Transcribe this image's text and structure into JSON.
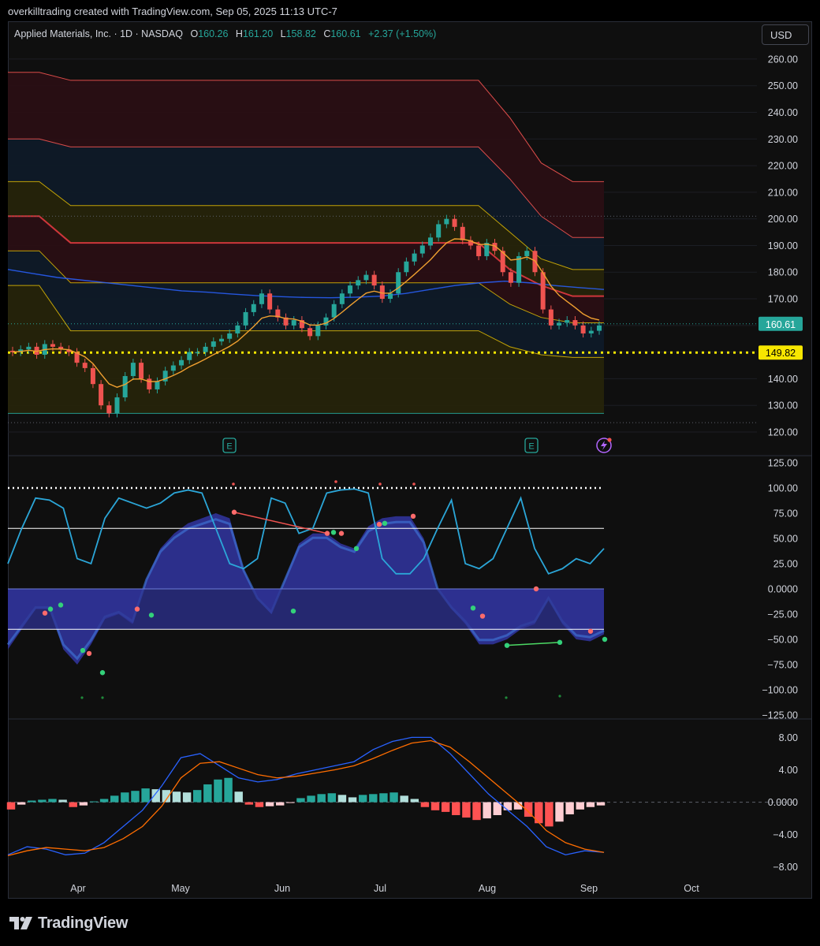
{
  "header": {
    "credit": "overkilltrading created with TradingView.com, Sep 05, 2025 11:13 UTC-7",
    "currency": "USD"
  },
  "legend": {
    "symbol": "Applied Materials, Inc. · 1D · NASDAQ",
    "open_label": "O",
    "open": "160.26",
    "high_label": "H",
    "high": "161.20",
    "low_label": "L",
    "low": "158.82",
    "close_label": "C",
    "close": "160.61",
    "change": "+2.37 (+1.50%)"
  },
  "footer": {
    "brand": "TradingView"
  },
  "colors": {
    "up": "#26a69a",
    "down": "#ef5350",
    "macd_line": "#2962ff",
    "signal_line": "#ff6d00",
    "wt1": "#2ba6d8",
    "fill": "#2e3192",
    "price_tag_green": "#26a69a",
    "price_tag_yellow": "#f7e600"
  },
  "chart_data": [
    {
      "type": "candlestick",
      "ylim": [
        120,
        265
      ],
      "yticks": [
        "260.00",
        "250.00",
        "240.00",
        "230.00",
        "220.00",
        "210.00",
        "200.00",
        "190.00",
        "180.00",
        "170.00",
        "160.00",
        "150.00",
        "140.00",
        "130.00",
        "120.00"
      ],
      "ytick_values": [
        260,
        250,
        240,
        230,
        220,
        210,
        200,
        190,
        180,
        170,
        160,
        150,
        140,
        130,
        120
      ],
      "xticks": [
        "Apr",
        "May",
        "Jun",
        "Jul",
        "Aug",
        "Sep",
        "Oct"
      ],
      "last_price": "160.61",
      "level_line": "149.82",
      "earnings_markers": [
        "E",
        "E"
      ],
      "close_path": [
        150,
        151,
        152,
        149,
        153,
        152,
        151,
        150,
        146,
        144,
        138,
        130,
        127,
        133,
        141,
        146,
        140,
        136,
        139,
        143,
        145,
        147,
        150,
        150,
        152,
        154,
        155,
        157,
        160,
        165,
        168,
        172,
        166,
        163,
        160,
        162,
        159,
        156,
        160,
        163,
        168,
        172,
        175,
        177,
        179,
        175,
        170,
        172,
        180,
        184,
        187,
        190,
        193,
        198,
        200,
        197,
        192,
        190,
        186,
        191,
        188,
        180,
        176,
        186,
        188,
        180,
        166,
        160,
        161,
        162,
        160,
        157,
        158,
        160
      ],
      "bands": [
        {
          "name": "",
          "values": [
            255,
            255,
            252,
            252,
            252,
            252,
            252,
            252,
            252,
            252,
            252,
            252,
            252,
            252,
            252,
            252,
            238,
            221,
            214,
            214
          ]
        },
        {
          "name": "",
          "values": [
            230,
            230,
            227,
            227,
            227,
            227,
            227,
            227,
            227,
            227,
            227,
            227,
            227,
            227,
            227,
            227,
            215,
            201,
            193,
            193
          ]
        },
        {
          "name": "",
          "values": [
            214,
            214,
            205,
            205,
            205,
            205,
            205,
            205,
            205,
            205,
            205,
            205,
            205,
            205,
            205,
            205,
            195,
            185,
            181,
            181
          ]
        },
        {
          "name": "",
          "values": [
            201,
            201,
            191,
            191,
            191,
            191,
            191,
            191,
            191,
            191,
            191,
            191,
            191,
            191,
            191,
            191,
            181,
            175,
            171,
            171
          ]
        },
        {
          "name": "",
          "values": [
            188,
            188,
            176,
            176,
            176,
            176,
            176,
            176,
            176,
            176,
            176,
            176,
            176,
            176,
            176,
            176,
            168,
            163,
            161,
            161
          ]
        },
        {
          "name": "",
          "values": [
            175,
            175,
            158,
            158,
            158,
            158,
            158,
            158,
            158,
            158,
            158,
            158,
            158,
            158,
            158,
            158,
            152,
            149,
            148,
            148
          ]
        },
        {
          "name": "",
          "values": [
            127,
            127,
            127,
            127,
            127,
            127,
            127,
            127,
            127,
            127,
            127,
            127,
            127,
            127,
            127,
            127,
            127,
            127,
            127,
            127
          ]
        }
      ]
    },
    {
      "type": "oscillator",
      "ylim": [
        -125,
        125
      ],
      "yticks": [
        "125.00",
        "100.00",
        "75.00",
        "50.00",
        "25.00",
        "0.0000",
        "−25.00",
        "−50.00",
        "−75.00",
        "−100.00",
        "−125.00"
      ],
      "ytick_values": [
        125,
        100,
        75,
        50,
        25,
        0,
        -25,
        -50,
        -75,
        -100,
        -125
      ],
      "reference_lines": [
        100,
        60,
        0,
        -40
      ],
      "fast_line": [
        25,
        60,
        90,
        88,
        80,
        30,
        25,
        70,
        90,
        85,
        80,
        85,
        95,
        98,
        95,
        60,
        25,
        20,
        30,
        90,
        85,
        55,
        60,
        95,
        98,
        99,
        95,
        30,
        15,
        15,
        30,
        60,
        88,
        25,
        20,
        30,
        60,
        90,
        40,
        15,
        20,
        30,
        25,
        40
      ],
      "wave": [
        -60,
        -40,
        -20,
        -20,
        -60,
        -75,
        -55,
        -30,
        -25,
        -35,
        10,
        40,
        55,
        65,
        70,
        75,
        70,
        20,
        -10,
        -25,
        10,
        45,
        55,
        55,
        45,
        40,
        62,
        70,
        72,
        72,
        50,
        0,
        -20,
        -35,
        -55,
        -55,
        -50,
        -40,
        -35,
        -10,
        -35,
        -50,
        -52,
        -45
      ]
    },
    {
      "type": "macd",
      "ylim": [
        -9,
        9.5
      ],
      "yticks": [
        "8.00",
        "4.00",
        "0.0000",
        "−4.00",
        "−8.00"
      ],
      "ytick_values": [
        8,
        4,
        0,
        -4,
        -8
      ],
      "macd": [
        -6.5,
        -5.5,
        -5.8,
        -6.5,
        -6.3,
        -5,
        -3,
        -1,
        2,
        5.5,
        6,
        4.5,
        3,
        2.5,
        2.8,
        3.5,
        4,
        4.5,
        5,
        6.5,
        7.5,
        8,
        8,
        6,
        3.5,
        1,
        -1,
        -3,
        -5.5,
        -6.5,
        -6,
        -6.2
      ],
      "signal": [
        -6.6,
        -6,
        -5.6,
        -5.8,
        -6,
        -5.6,
        -4.5,
        -3,
        -0.5,
        3,
        4.8,
        5,
        4.2,
        3.4,
        3,
        3.2,
        3.6,
        4,
        4.5,
        5.4,
        6.4,
        7.3,
        7.6,
        6.8,
        5,
        3,
        1,
        -1,
        -3.5,
        -5,
        -5.8,
        -6.2
      ],
      "histogram": [
        -0.9,
        -0.3,
        0.2,
        0.3,
        0.4,
        0.3,
        -0.6,
        -0.4,
        0.1,
        0.4,
        0.8,
        1.2,
        1.4,
        1.7,
        1.6,
        1.5,
        1.3,
        1.2,
        1.5,
        2.2,
        2.8,
        3.0,
        1.3,
        -0.3,
        -0.6,
        -0.5,
        -0.4,
        -0.1,
        0.5,
        0.8,
        1.0,
        1.1,
        0.9,
        0.6,
        0.9,
        1.0,
        1.1,
        1.2,
        0.8,
        0.4,
        -0.6,
        -1.0,
        -1.2,
        -1.6,
        -1.9,
        -2.2,
        -2.0,
        -1.6,
        -1.0,
        -0.9,
        -1.8,
        -2.6,
        -3.0,
        -2.4,
        -1.5,
        -0.9,
        -0.6,
        -0.4
      ]
    }
  ]
}
